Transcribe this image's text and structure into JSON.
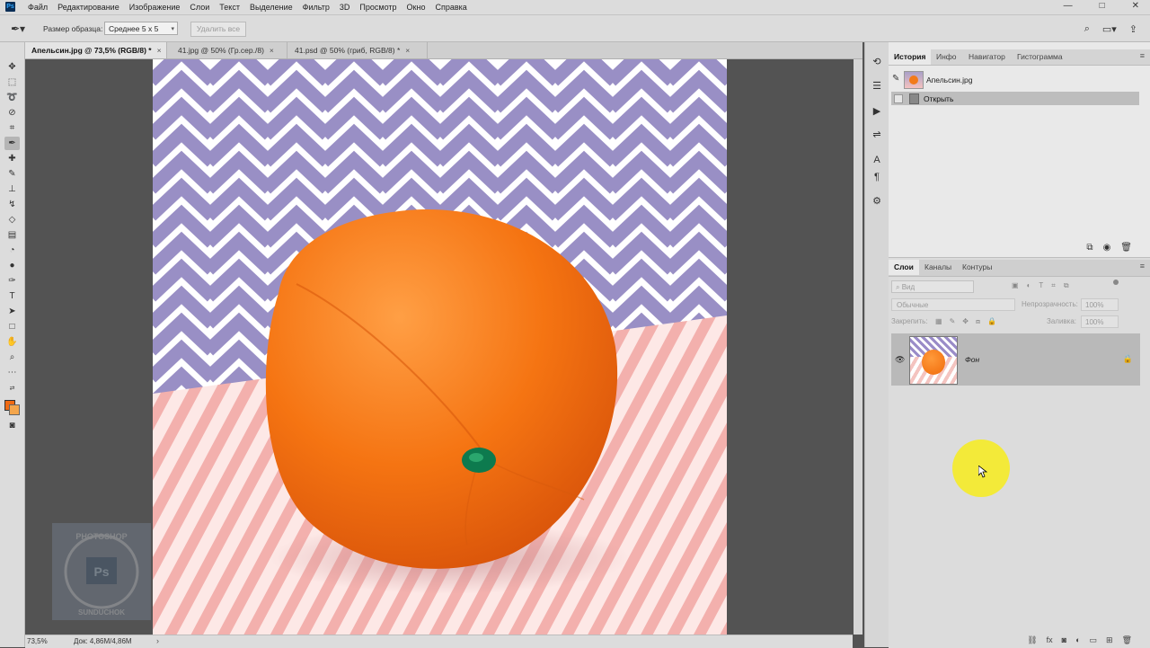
{
  "app": {
    "logo": "Ps"
  },
  "menu": [
    "Файл",
    "Редактирование",
    "Изображение",
    "Слои",
    "Текст",
    "Выделение",
    "Фильтр",
    "3D",
    "Просмотр",
    "Окно",
    "Справка"
  ],
  "window_controls": {
    "minimize": "—",
    "maximize": "□",
    "close": "✕"
  },
  "options": {
    "tool_icon": "eyedropper-icon",
    "sample_size_label": "Размер образца:",
    "sample_size_value": "Среднее 5 x 5",
    "delete_all": "Удалить все"
  },
  "tabs": [
    {
      "label": "Апельсин.jpg @ 73,5% (RGB/8) *",
      "close": "×",
      "active": true
    },
    {
      "label": "41.jpg @ 50% (Гр.сер./8)",
      "close": "×",
      "active": false
    },
    {
      "label": "41.psd @ 50% (гриб, RGB/8) *",
      "close": "×",
      "active": false
    }
  ],
  "status": {
    "zoom": "73,5%",
    "doc": "Док: 4,86M/4,86M",
    "arrow": "›"
  },
  "colors": {
    "foreground": "#f06a12",
    "background": "#f4a64c",
    "highlight": "#f4ea2a"
  },
  "history_panel": {
    "tabs": [
      "История",
      "Инфо",
      "Навигатор",
      "Гистограмма"
    ],
    "snapshot_name": "Апельсин.jpg",
    "steps": [
      "Открыть"
    ]
  },
  "layers_panel": {
    "tabs": [
      "Слои",
      "Каналы",
      "Контуры"
    ],
    "search_placeholder": "Вид",
    "blend_mode": "Обычные",
    "opacity_label": "Непрозрачность:",
    "opacity_value": "100%",
    "lock_label": "Закрепить:",
    "fill_label": "Заливка:",
    "fill_value": "100%",
    "layers": [
      {
        "name": "Фон",
        "visible": true,
        "locked": true
      }
    ]
  },
  "watermark": {
    "top_text": "PHOTOSHOP",
    "bottom_text": "SUNDUCHOK",
    "mark": "Ps"
  }
}
